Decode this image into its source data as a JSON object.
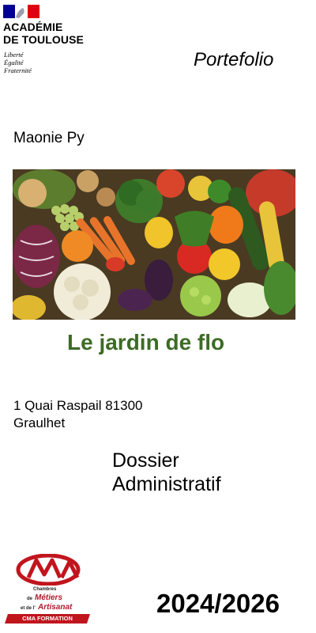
{
  "header": {
    "academie": {
      "name_line1": "ACADÉMIE",
      "name_line2": "DE TOULOUSE",
      "motto": [
        "Liberté",
        "Égalité",
        "Fraternité"
      ]
    },
    "portfolio_label": "Portefolio"
  },
  "author": "Maonie Py",
  "image": {
    "alt": "Assortiment de fruits et légumes"
  },
  "business": {
    "name": "Le jardin de flo",
    "address": "1 Quai Raspail 81300 Graulhet"
  },
  "document_title": "Dossier Administratif",
  "footer": {
    "cma": {
      "line1": "Chambres",
      "line2_pre": "de",
      "line2": "Métiers",
      "line3_pre": "et de l'",
      "line3": "Artisanat",
      "banner": "CMA FORMATION"
    },
    "years": "2024/2026"
  },
  "colors": {
    "business_green": "#3e6b26",
    "cma_red": "#c1151e",
    "flag_blue": "#000091",
    "flag_red": "#e1000f"
  }
}
